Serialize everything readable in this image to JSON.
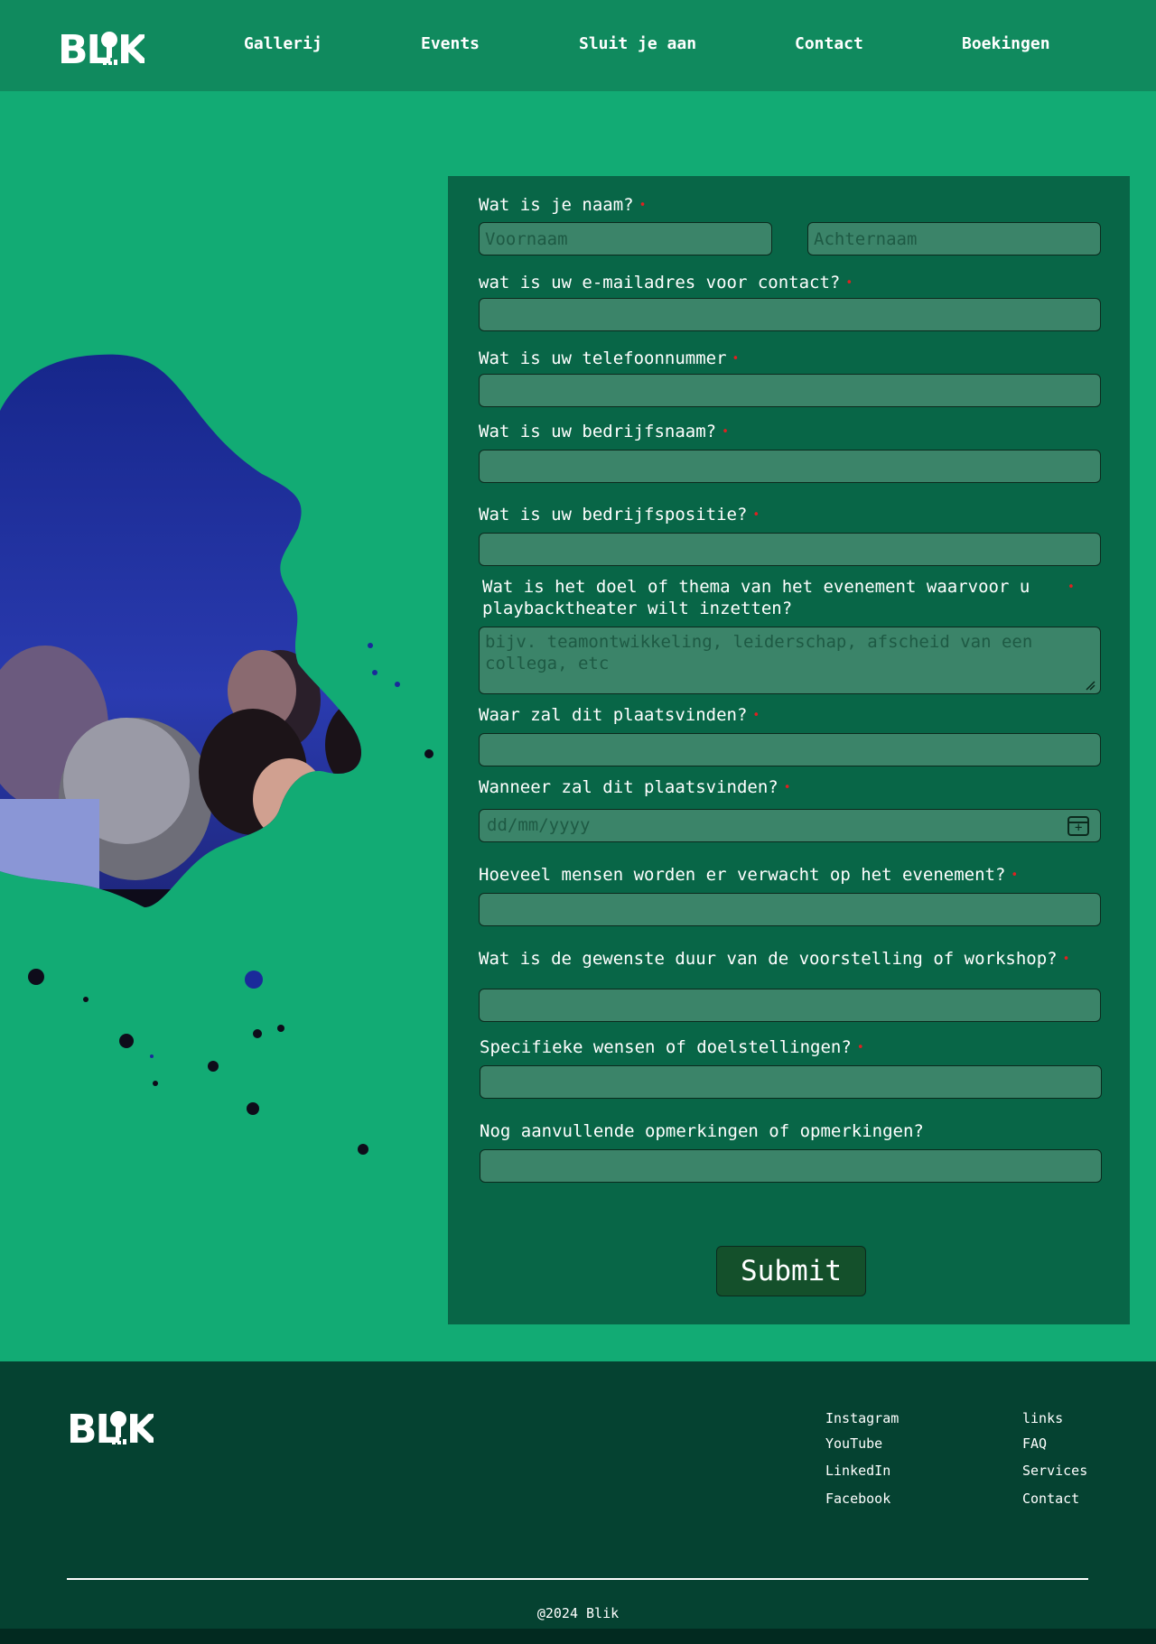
{
  "brand": {
    "logo_text": "BLIK"
  },
  "nav": {
    "items": [
      {
        "label": "Gallerij"
      },
      {
        "label": "Events"
      },
      {
        "label": "Sluit je aan"
      },
      {
        "label": "Contact"
      },
      {
        "label": "Boekingen"
      }
    ]
  },
  "form": {
    "required_marker": "•",
    "questions": {
      "name": {
        "label": "Wat is je naam?",
        "first_placeholder": "Voornaam",
        "last_placeholder": "Achternaam"
      },
      "email": {
        "label": "wat is uw e-mailadres voor contact?"
      },
      "phone": {
        "label": "Wat is uw telefoonnummer"
      },
      "company": {
        "label": "Wat is uw bedrijfsnaam?"
      },
      "position": {
        "label": "Wat is uw bedrijfspositie?"
      },
      "theme": {
        "label": "Wat is het doel of thema van het evenement waarvoor u playbacktheater wilt inzetten?",
        "placeholder": "bijv. teamontwikkeling, leiderschap, afscheid van een collega, etc"
      },
      "location": {
        "label": "Waar zal dit plaatsvinden?"
      },
      "date": {
        "label": "Wanneer zal dit plaatsvinden?",
        "placeholder": "dd/mm/yyyy"
      },
      "attendees": {
        "label": "Hoeveel mensen worden er verwacht op het evenement?"
      },
      "duration": {
        "label": "Wat is de gewenste duur van de voorstelling of workshop?"
      },
      "wishes": {
        "label": "Specifieke wensen of doelstellingen?"
      },
      "remarks": {
        "label": "Nog aanvullende opmerkingen of opmerkingen?"
      }
    },
    "submit_label": "Submit"
  },
  "footer": {
    "logo_text": "BLIK",
    "social": [
      "Instagram",
      "YouTube",
      "LinkedIn",
      "Facebook"
    ],
    "links": [
      "links",
      "FAQ",
      "Services",
      "Contact"
    ],
    "copyright": "@2024 Blik"
  },
  "colors": {
    "page_bg": "#12ab74",
    "header_bg": "#108a5e",
    "form_bg": "#086647",
    "field_bg": "#3b8469",
    "submit_bg": "#14502b",
    "footer_bg": "#054231",
    "required": "#e02020"
  }
}
